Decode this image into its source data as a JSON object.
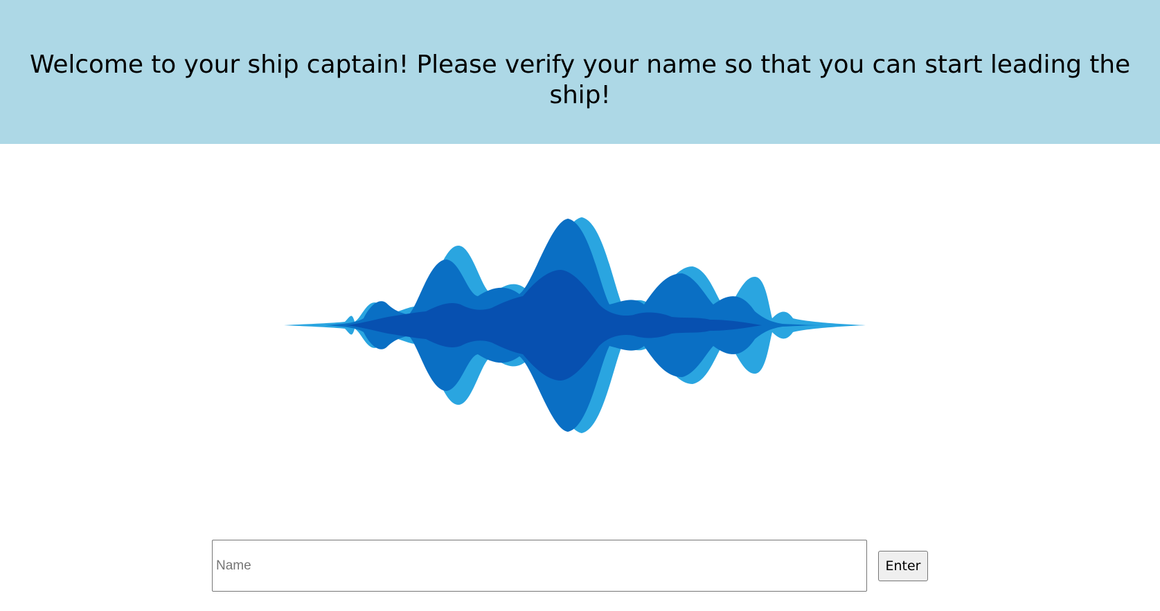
{
  "header": {
    "welcome_text": "Welcome to your ship captain! Please verify your name so that you can start leading the ship!"
  },
  "logo": {
    "icon": "sound-wave-icon",
    "colors": {
      "light": "#2aa5e0",
      "mid": "#0a6fc4",
      "dark": "#0750b0"
    }
  },
  "form": {
    "name_placeholder": "Name",
    "name_value": "",
    "enter_label": "Enter"
  },
  "colors": {
    "header_background": "#add8e6"
  }
}
